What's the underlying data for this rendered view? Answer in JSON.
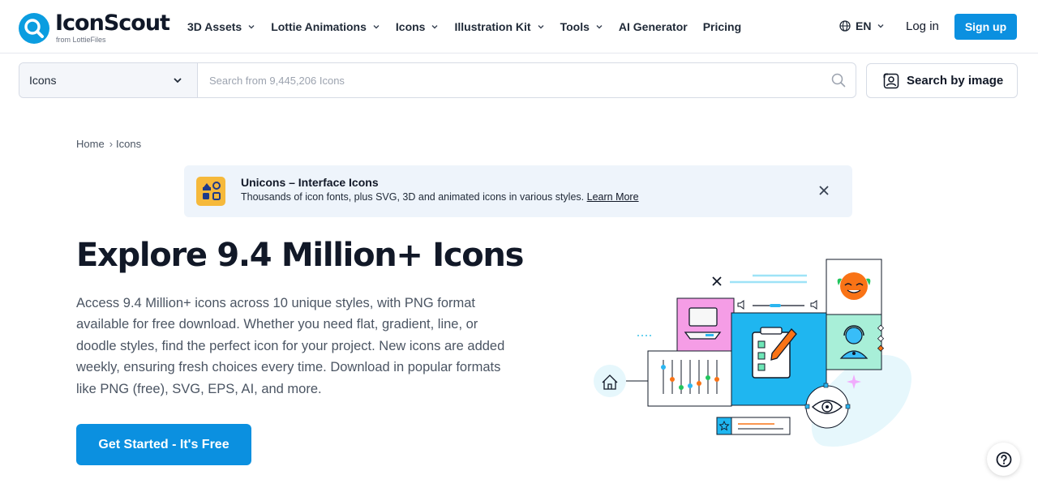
{
  "header": {
    "logo_name": "IconScout",
    "logo_sub": "from LottieFiles",
    "nav": [
      {
        "label": "3D Assets",
        "dropdown": true
      },
      {
        "label": "Lottie Animations",
        "dropdown": true
      },
      {
        "label": "Icons",
        "dropdown": true
      },
      {
        "label": "Illustration Kit",
        "dropdown": true
      },
      {
        "label": "Tools",
        "dropdown": true
      },
      {
        "label": "AI Generator",
        "dropdown": false
      },
      {
        "label": "Pricing",
        "dropdown": false
      }
    ],
    "language": "EN",
    "login_label": "Log in",
    "signup_label": "Sign up"
  },
  "search": {
    "category": "Icons",
    "placeholder": "Search from 9,445,206 Icons",
    "value": "",
    "image_search_label": "Search by image"
  },
  "breadcrumb": {
    "home": "Home",
    "separator": "›",
    "current": "Icons"
  },
  "promo": {
    "title": "Unicons – Interface Icons",
    "text": "Thousands of icon fonts, plus SVG, 3D and animated icons in various styles.",
    "link": "Learn More"
  },
  "hero": {
    "title": "Explore 9.4 Million+ Icons",
    "description": "Access 9.4 Million+ icons across 10 unique styles, with PNG format available for free download. Whether you need flat, gradient, line, or doodle styles, find the perfect icon for your project. New icons are added weekly, ensuring fresh choices every time. Download in popular formats like PNG (free), SVG, EPS, AI, and more.",
    "cta_label": "Get Started - It's Free"
  },
  "colors": {
    "brand_blue": "#0b90e0",
    "promo_bg": "#eef4fb",
    "illustration_cyan": "#1fb6f0",
    "illustration_pink": "#f59de6",
    "illustration_mint": "#a8efd8"
  },
  "icons": [
    "logo-search-icon",
    "chevron-down-icon",
    "globe-icon",
    "search-icon",
    "image-search-icon",
    "close-icon",
    "help-icon"
  ]
}
